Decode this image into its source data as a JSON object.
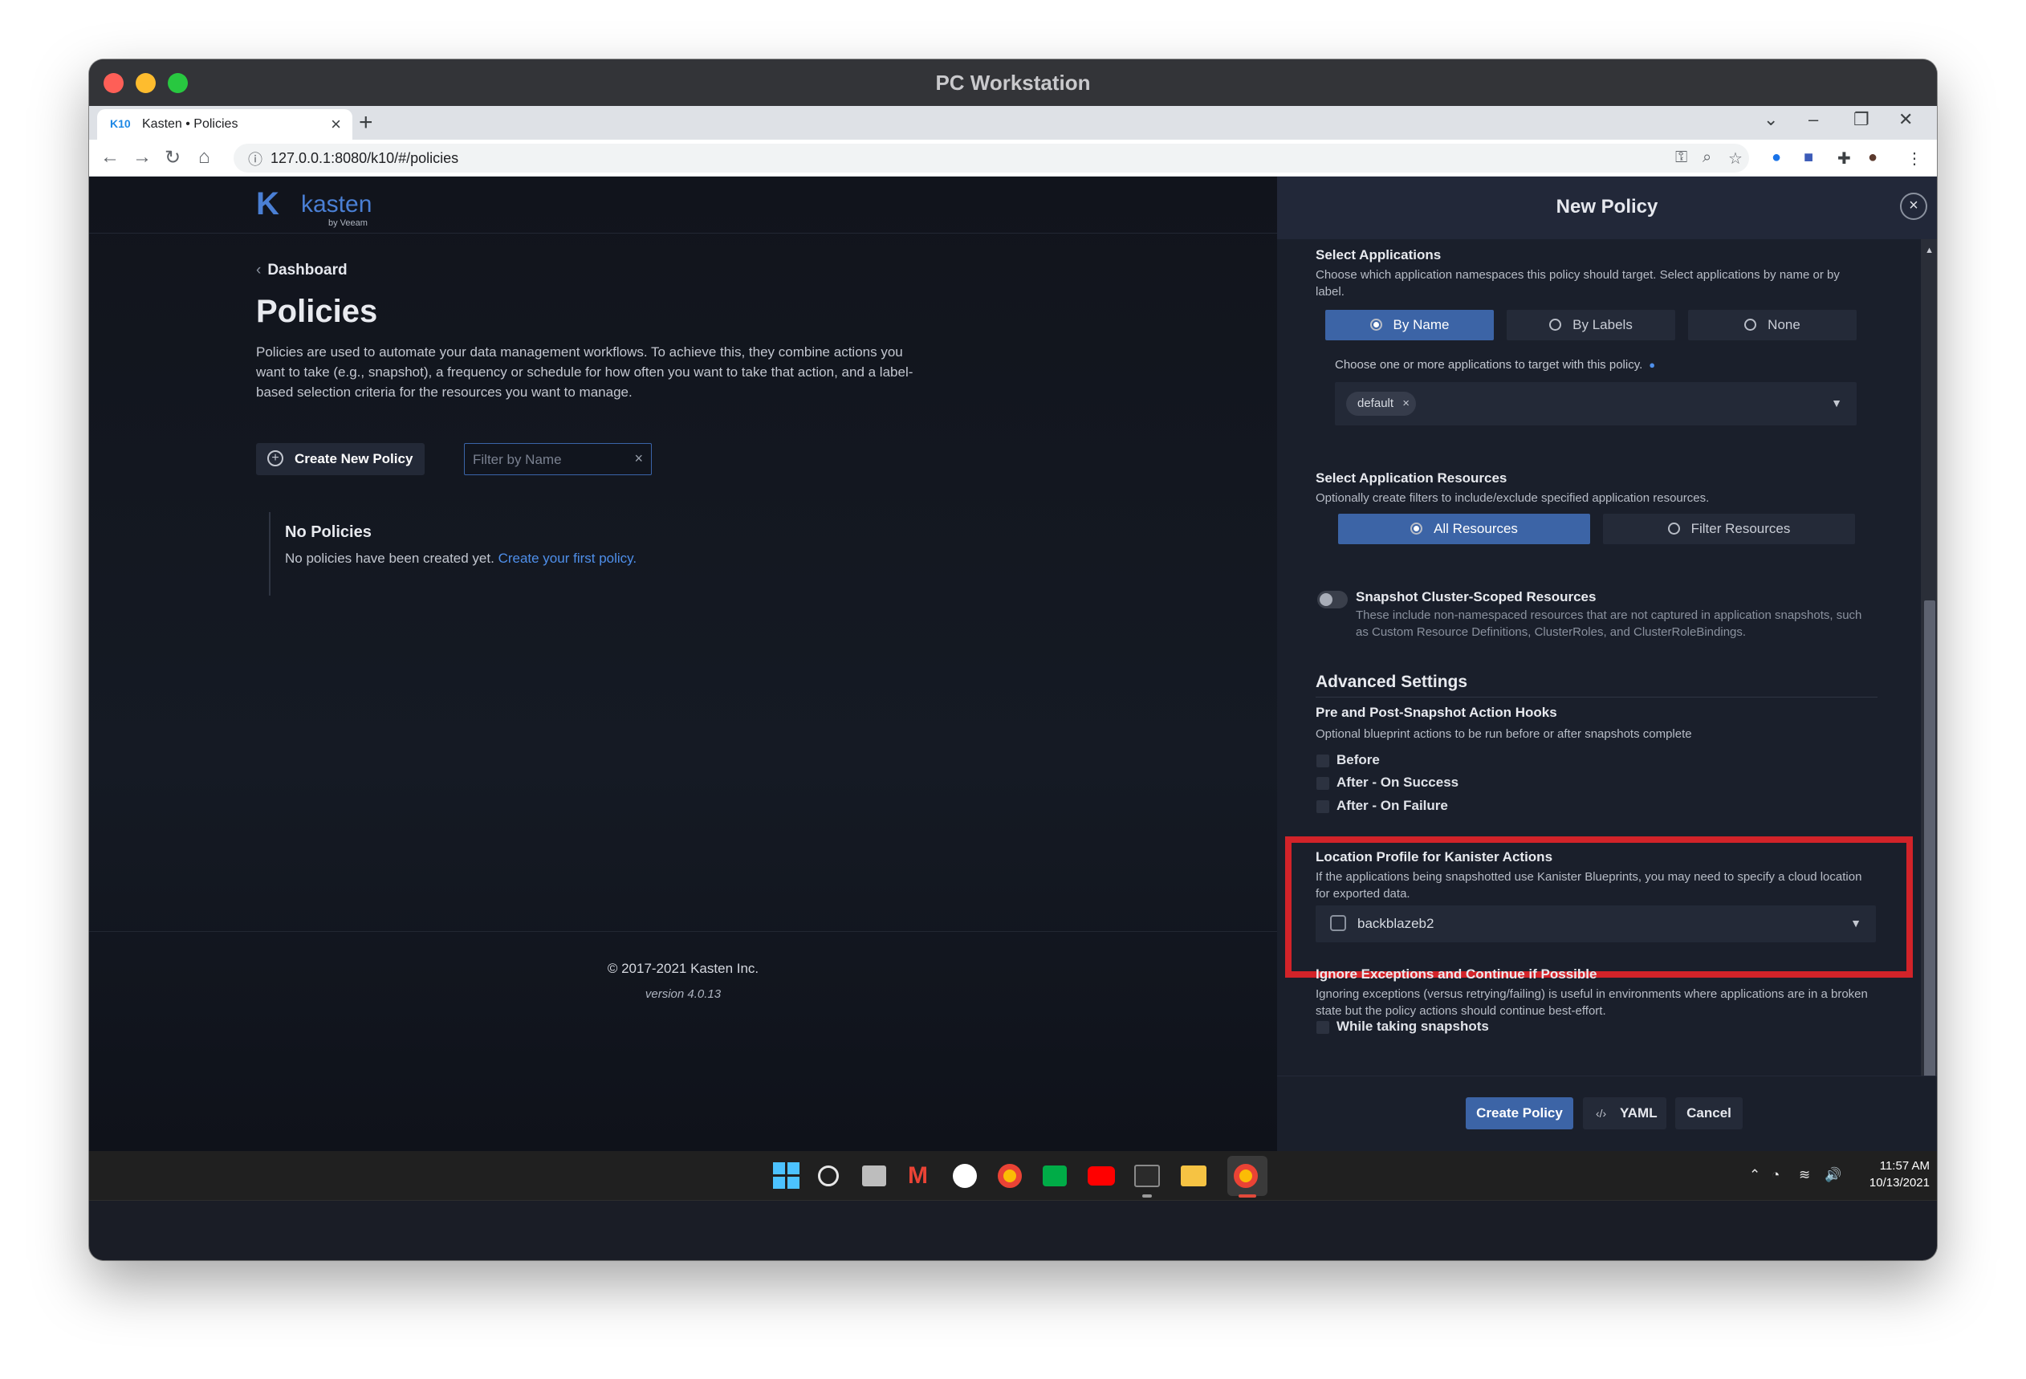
{
  "window": {
    "title": "PC Workstation"
  },
  "browser": {
    "tab_title": "Kasten • Policies",
    "tab_favicon": "K10",
    "url": "127.0.0.1:8080/k10/#/policies"
  },
  "app": {
    "logo_mark": "K",
    "logo_word": "kasten",
    "logo_by": "by Veeam",
    "breadcrumb": "Dashboard",
    "page_title": "Policies",
    "description": "Policies are used to automate your data management workflows. To achieve this, they combine actions you want to take (e.g., snapshot), a frequency or schedule for how often you want to take that action, and a label-based selection criteria for the resources you want to manage.",
    "create_button": "Create New Policy",
    "filter_placeholder": "Filter by Name",
    "empty_title": "No Policies",
    "empty_text": "No policies have been created yet.",
    "empty_link": "Create your first policy.",
    "copyright": "© 2017-2021 Kasten Inc.",
    "version": "version 4.0.13"
  },
  "drawer": {
    "title": "New Policy",
    "select_apps": {
      "title": "Select Applications",
      "desc": "Choose which application namespaces this policy should target. Select applications by name or by label.",
      "options": [
        "By Name",
        "By Labels",
        "None"
      ],
      "selected": "By Name",
      "choose_label": "Choose one or more applications to target with this policy.",
      "selected_chip": "default"
    },
    "select_resources": {
      "title": "Select Application Resources",
      "desc": "Optionally create filters to include/exclude specified application resources.",
      "options": [
        "All Resources",
        "Filter Resources"
      ],
      "selected": "All Resources"
    },
    "snapshot_cluster": {
      "title": "Snapshot Cluster-Scoped Resources",
      "desc": "These include non-namespaced resources that are not captured in application snapshots, such as Custom Resource Definitions, ClusterRoles, and ClusterRoleBindings.",
      "enabled": false
    },
    "advanced": {
      "title": "Advanced Settings",
      "hooks_title": "Pre and Post-Snapshot Action Hooks",
      "hooks_desc": "Optional blueprint actions to be run before or after snapshots complete",
      "hooks": [
        "Before",
        "After - On Success",
        "After - On Failure"
      ],
      "location_title": "Location Profile for Kanister Actions",
      "location_desc": "If the applications being snapshotted use Kanister Blueprints, you may need to specify a cloud location for exported data.",
      "location_value": "backblazeb2",
      "ignore_title": "Ignore Exceptions and Continue if Possible",
      "ignore_desc": "Ignoring exceptions (versus retrying/failing) is useful in environments where applications are in a broken state but the policy actions should continue best-effort.",
      "ignore_option": "While taking snapshots"
    },
    "footer": {
      "create": "Create Policy",
      "yaml": "YAML",
      "cancel": "Cancel"
    }
  },
  "taskbar": {
    "time": "11:57 AM",
    "date": "10/13/2021"
  },
  "colors": {
    "accent": "#3c64a6",
    "link": "#4f8fea",
    "highlight": "#d22329"
  }
}
